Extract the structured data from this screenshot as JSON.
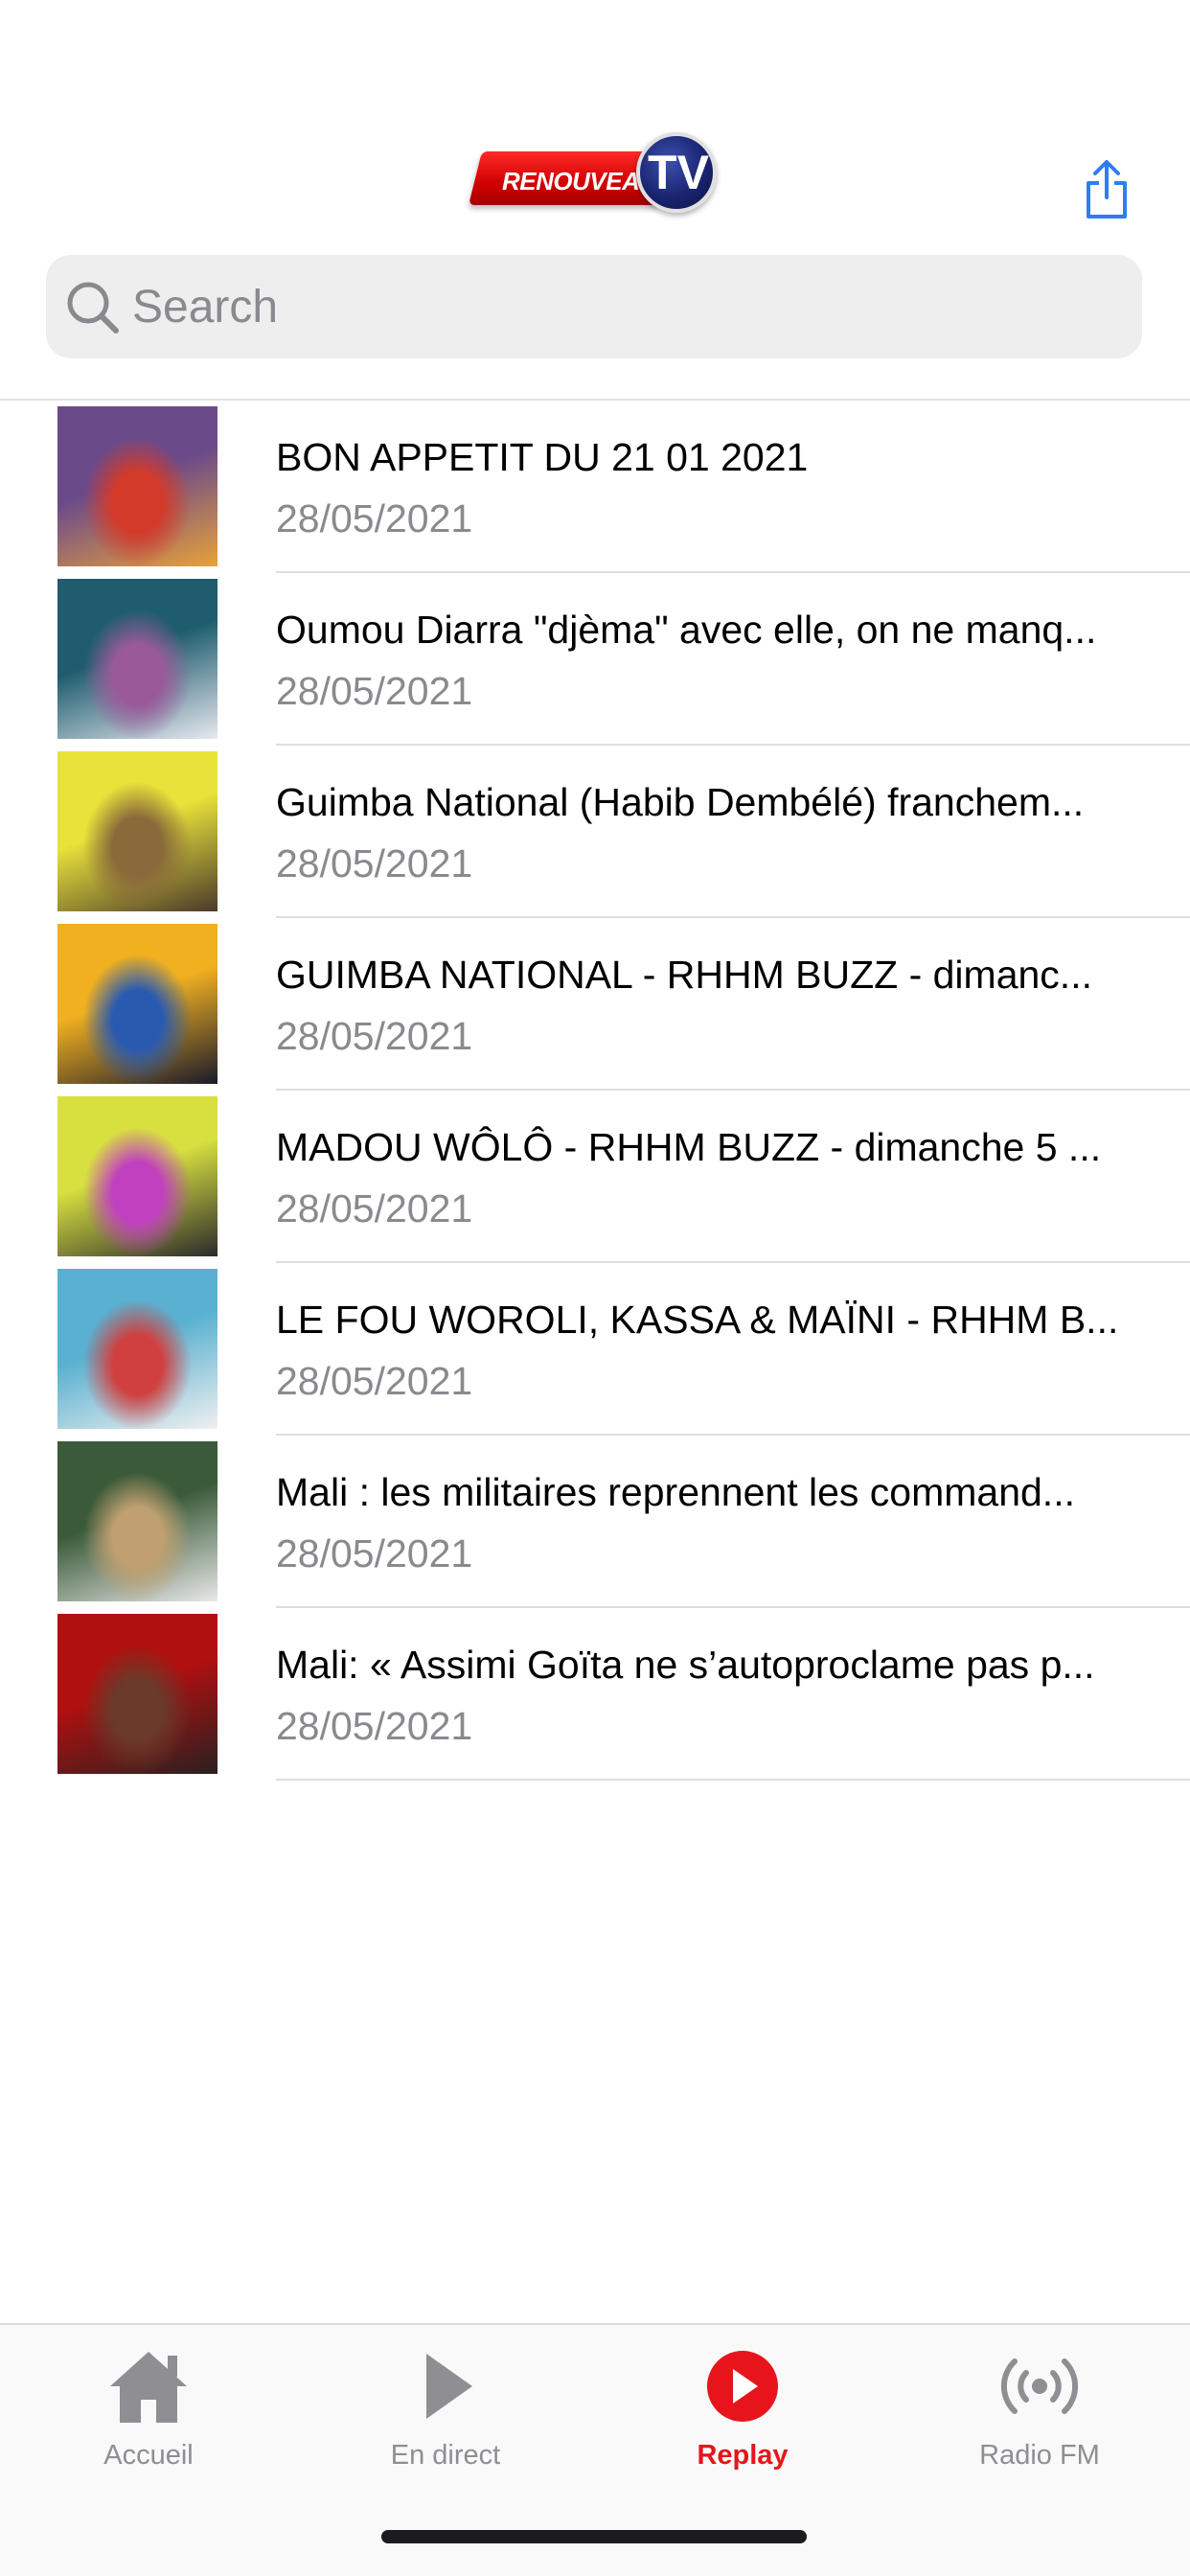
{
  "header": {
    "logo_text": "RENOUVEAU",
    "logo_badge": "TV",
    "share_icon": "share-icon"
  },
  "search": {
    "placeholder": "Search",
    "icon": "search-icon"
  },
  "list": {
    "items": [
      {
        "title": "BON APPETIT DU 21 01 2021",
        "date": "28/05/2021",
        "thumb_colors": [
          "#6b4a8a",
          "#d33a2a",
          "#e8a13a"
        ]
      },
      {
        "title": "Oumou Diarra \"djèma\" avec elle, on ne manq...",
        "date": "28/05/2021",
        "thumb_colors": [
          "#1f5d6e",
          "#9a5a9a",
          "#e8e8f0"
        ]
      },
      {
        "title": "Guimba National (Habib Dembélé) franchem...",
        "date": "28/05/2021",
        "thumb_colors": [
          "#e8e23a",
          "#8a6a3a",
          "#4a3a2a"
        ]
      },
      {
        "title": "GUIMBA NATIONAL - RHHM BUZZ - dimanc...",
        "date": "28/05/2021",
        "thumb_colors": [
          "#f0b020",
          "#2a5ab0",
          "#1a1a2a"
        ]
      },
      {
        "title": "MADOU WÔLÔ - RHHM BUZZ - dimanche 5 ...",
        "date": "28/05/2021",
        "thumb_colors": [
          "#d8e040",
          "#c040c0",
          "#2a2a2a"
        ]
      },
      {
        "title": "LE FOU WOROLI, KASSA & MAÏNI - RHHM B...",
        "date": "28/05/2021",
        "thumb_colors": [
          "#5ab0d0",
          "#d04040",
          "#f0f0f0"
        ]
      },
      {
        "title": "Mali : les militaires reprennent les command...",
        "date": "28/05/2021",
        "thumb_colors": [
          "#3a5a3a",
          "#c0a070",
          "#e8e8e8"
        ]
      },
      {
        "title": "Mali: « Assimi Goïta ne s’autoproclame pas p...",
        "date": "28/05/2021",
        "thumb_colors": [
          "#b01010",
          "#6a3a2a",
          "#2a2020"
        ]
      }
    ]
  },
  "tabbar": {
    "tabs": [
      {
        "label": "Accueil",
        "icon": "home-icon",
        "active": false
      },
      {
        "label": "En direct",
        "icon": "play-icon",
        "active": false
      },
      {
        "label": "Replay",
        "icon": "replay-icon",
        "active": true
      },
      {
        "label": "Radio FM",
        "icon": "radio-icon",
        "active": false
      }
    ],
    "active_color": "#e8141c",
    "inactive_color": "#8e8e93"
  }
}
